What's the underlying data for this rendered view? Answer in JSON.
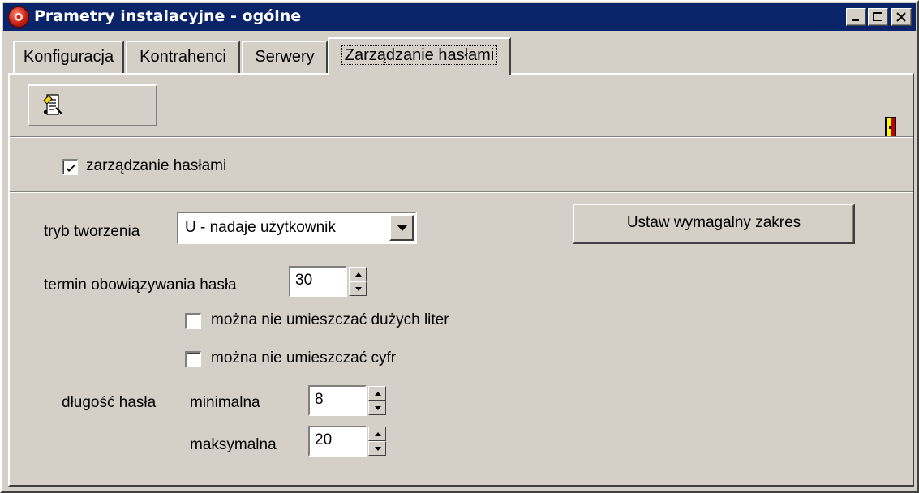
{
  "window": {
    "title": "Prametry instalacyjne - ogólne",
    "icon": "app-logo-icon"
  },
  "caption_buttons": {
    "minimize_icon": "minimize-icon",
    "maximize_icon": "maximize-icon",
    "close_icon": "close-icon"
  },
  "tabs": [
    {
      "label": "Konfiguracja",
      "active": false
    },
    {
      "label": "Kontrahenci",
      "active": false
    },
    {
      "label": "Serwery",
      "active": false
    },
    {
      "label": "Zarządzanie hasłami",
      "active": true
    }
  ],
  "toolbar": {
    "action_icon": "edit-document-icon",
    "exit_icon": "exit-door-icon"
  },
  "password_management": {
    "label": "zarządzanie hasłami",
    "checked": true
  },
  "creation_mode": {
    "label": "tryb tworzenia",
    "value": "U - nadaje użytkownik"
  },
  "set_range_button": {
    "label": "Ustaw wymagalny zakres"
  },
  "validity": {
    "label": "termin obowiązywania hasła",
    "value": "30"
  },
  "no_uppercase": {
    "label": "można nie umieszczać dużych liter",
    "checked": false
  },
  "no_digits": {
    "label": "można nie umieszczać cyfr",
    "checked": false
  },
  "length": {
    "label": "długość hasła",
    "min_label": "minimalna",
    "min_value": "8",
    "max_label": "maksymalna",
    "max_value": "20"
  },
  "colors": {
    "face": "#d4d0c8",
    "titlebar": "#0a246a",
    "exit_icon_yellow": "#ffff00",
    "exit_icon_red": "#c00000"
  }
}
